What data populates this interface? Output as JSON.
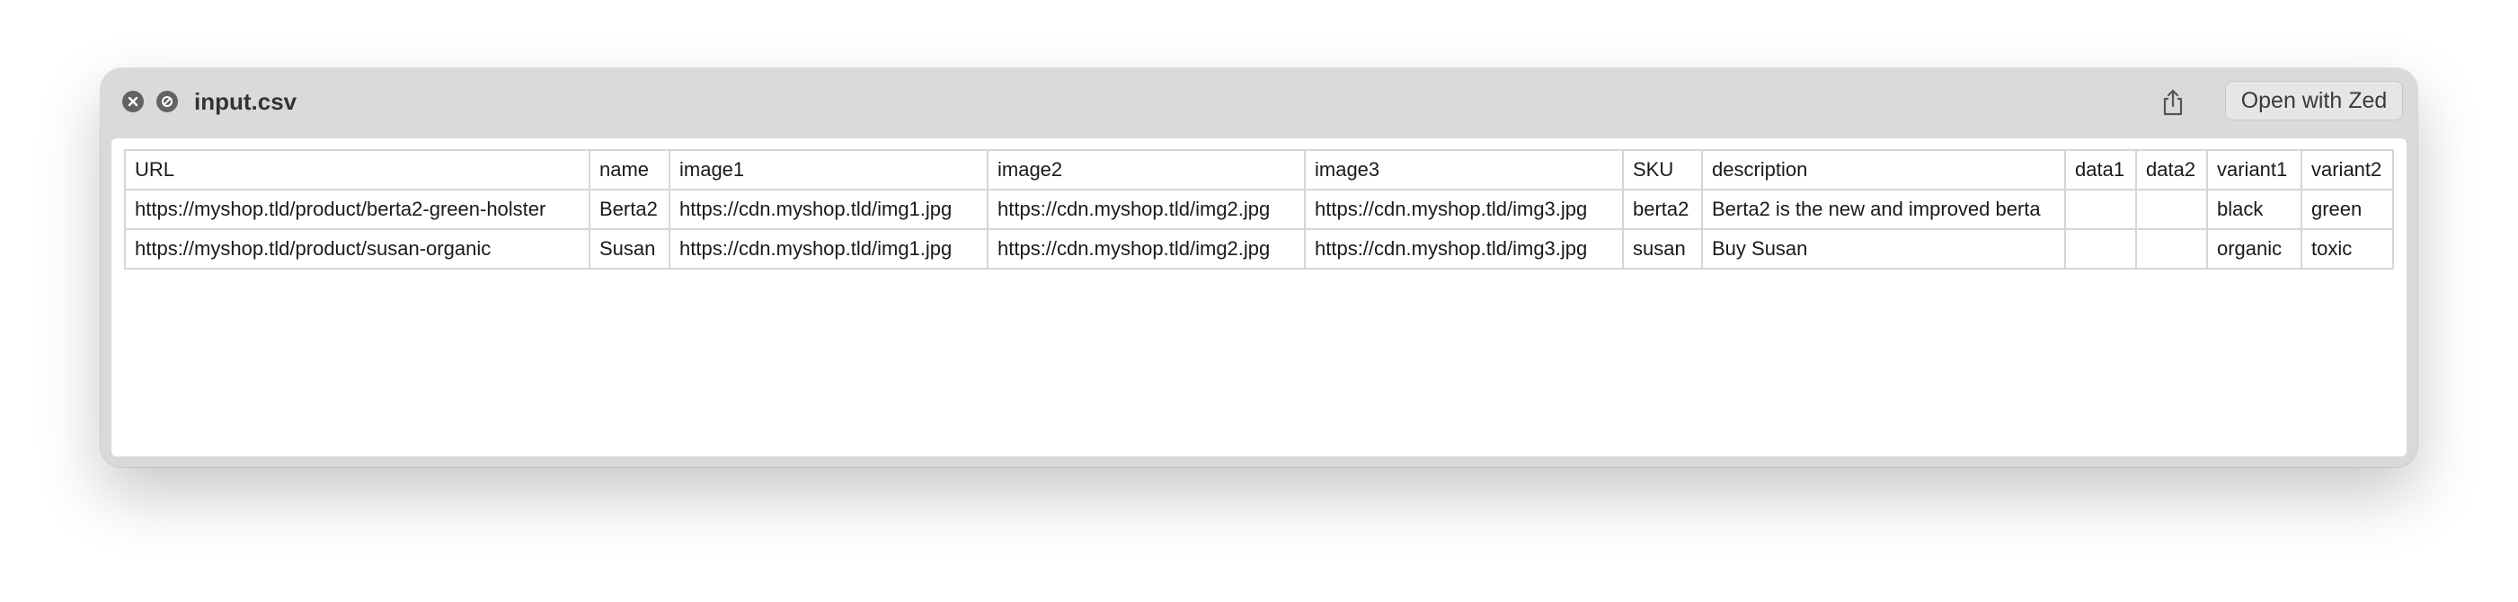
{
  "window": {
    "title": "input.csv",
    "open_button_label": "Open with Zed"
  },
  "icons": {
    "close": "close-icon",
    "no-symbol": "no-symbol-icon",
    "share": "share-icon"
  },
  "table": {
    "header": [
      "URL",
      "name",
      "image1",
      "image2",
      "image3",
      "SKU",
      "description",
      "data1",
      "data2",
      "variant1",
      "variant2"
    ],
    "rows": [
      [
        "https://myshop.tld/product/berta2-green-holster",
        "Berta2",
        "https://cdn.myshop.tld/img1.jpg",
        "https://cdn.myshop.tld/img2.jpg",
        "https://cdn.myshop.tld/img3.jpg",
        "berta2",
        "Berta2 is the new and improved berta",
        "",
        "",
        "black",
        "green"
      ],
      [
        "https://myshop.tld/product/susan-organic",
        "Susan",
        "https://cdn.myshop.tld/img1.jpg",
        "https://cdn.myshop.tld/img2.jpg",
        "https://cdn.myshop.tld/img3.jpg",
        "susan",
        "Buy Susan",
        "",
        "",
        "organic",
        "toxic"
      ]
    ]
  }
}
